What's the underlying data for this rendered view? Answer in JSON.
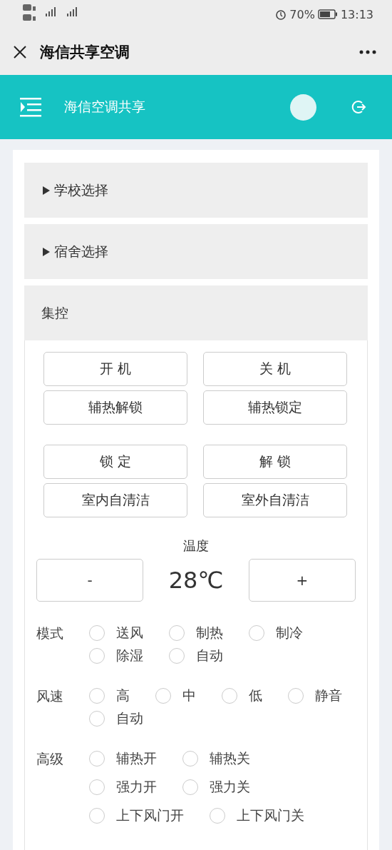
{
  "status_bar": {
    "battery": "70%",
    "time": "13:13"
  },
  "title_bar": {
    "title": "海信共享空调"
  },
  "header": {
    "title": "海信空调共享"
  },
  "sections": [
    {
      "title": "学校选择",
      "expanded": false
    },
    {
      "title": "宿舍选择",
      "expanded": false
    },
    {
      "title": "集控",
      "expanded": true
    }
  ],
  "button_groups": [
    [
      "开 机",
      "关 机",
      "辅热解锁",
      "辅热锁定"
    ],
    [
      "锁 定",
      "解 锁",
      "室内自清洁",
      "室外自清洁"
    ]
  ],
  "temperature": {
    "label": "温度",
    "minus": "-",
    "value": "28℃",
    "plus": "+"
  },
  "radio_groups": [
    {
      "label": "模式",
      "rows": [
        [
          {
            "label": "送风",
            "selected": false
          },
          {
            "label": "制热",
            "selected": false
          },
          {
            "label": "制冷",
            "selected": false
          }
        ],
        [
          {
            "label": "除湿",
            "selected": false
          },
          {
            "label": "自动",
            "selected": false
          }
        ]
      ]
    },
    {
      "label": "风速",
      "rows": [
        [
          {
            "label": "高",
            "selected": false
          },
          {
            "label": "中",
            "selected": false
          },
          {
            "label": "低",
            "selected": false
          },
          {
            "label": "静音",
            "selected": false
          }
        ],
        [
          {
            "label": "自动",
            "selected": false
          }
        ]
      ]
    },
    {
      "label": "高级",
      "rows": [
        [
          {
            "label": "辅热开",
            "selected": false
          },
          {
            "label": "辅热关",
            "selected": false
          }
        ],
        [
          {
            "label": "强力开",
            "selected": false
          },
          {
            "label": "强力关",
            "selected": false
          }
        ],
        [
          {
            "label": "上下风门开",
            "selected": false
          },
          {
            "label": "上下风门关",
            "selected": false
          }
        ]
      ]
    }
  ]
}
